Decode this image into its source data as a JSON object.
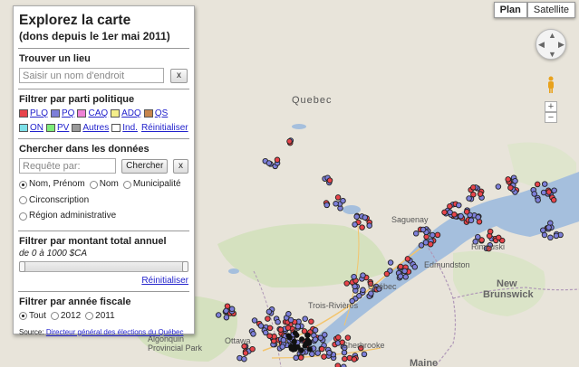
{
  "panel": {
    "title": "Explorez la carte",
    "subtitle": "(dons depuis le 1er mai 2011)",
    "place": {
      "heading": "Trouver un lieu",
      "placeholder": "Saisir un nom d'endroit",
      "clear_label": "x"
    },
    "parties": {
      "heading": "Filtrer par parti politique",
      "items": [
        {
          "label": "PLQ",
          "color": "#e8444a"
        },
        {
          "label": "PQ",
          "color": "#7d7fd9"
        },
        {
          "label": "CAQ",
          "color": "#ee82d6"
        },
        {
          "label": "ADQ",
          "color": "#f4ee8a"
        },
        {
          "label": "QS",
          "color": "#c8864c"
        },
        {
          "label": "ON",
          "color": "#7de0e8"
        },
        {
          "label": "PV",
          "color": "#7ded7a"
        },
        {
          "label": "Autres",
          "color": "#9a9a9a"
        },
        {
          "label": "Ind.",
          "color": "#ffffff"
        }
      ],
      "reset_label": "Réinitialiser"
    },
    "search": {
      "heading": "Chercher dans les données",
      "placeholder": "Requête par:",
      "search_label": "Chercher",
      "clear_label": "x",
      "options": [
        {
          "label": "Nom, Prénom",
          "selected": true
        },
        {
          "label": "Nom",
          "selected": false
        },
        {
          "label": "Municipalité",
          "selected": false
        },
        {
          "label": "Circonscription",
          "selected": false
        },
        {
          "label": "Région administrative",
          "selected": false
        }
      ]
    },
    "amount": {
      "heading": "Filtrer par montant total annuel",
      "range_text": "de 0 à 1000 $CA",
      "range_min": 0,
      "range_max": 1000,
      "reset_label": "Réinitialiser"
    },
    "year": {
      "heading": "Filtrer par année fiscale",
      "options": [
        {
          "label": "Tout",
          "selected": true
        },
        {
          "label": "2012",
          "selected": false
        },
        {
          "label": "2011",
          "selected": false
        }
      ]
    },
    "source": {
      "label": "Source:",
      "link": "Directeur général des élections du Québec"
    }
  },
  "map_controls": {
    "plan_label": "Plan",
    "satellite_label": "Satellite",
    "zoom_in": "+",
    "zoom_out": "−"
  },
  "map_labels": {
    "quebec": "Quebec",
    "saguenay": "Saguenay",
    "rimouski": "Rimouski",
    "edmundston": "Edmundston",
    "new_brunswick_1": "New",
    "new_brunswick_2": "Brunswick",
    "maine": "Maine",
    "sherbrooke": "Sherbrooke",
    "trois_rivieres": "Trois-Rivières",
    "algonquin_1": "Algonquin",
    "algonquin_2": "Provincial Park",
    "ottawa": "Ottawa",
    "quebec_city": "Québec"
  }
}
